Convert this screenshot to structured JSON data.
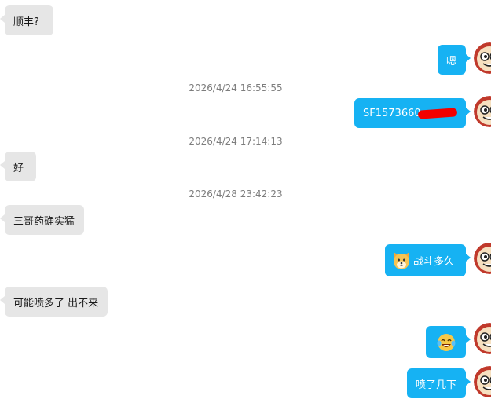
{
  "messages": [
    {
      "side": "in",
      "text": "顺丰?"
    },
    {
      "side": "out",
      "text": "嗯"
    },
    {
      "timestamp": "2026/4/24 16:55:55"
    },
    {
      "side": "out",
      "text": "SF1573660"
    },
    {
      "timestamp": "2026/4/24 17:14:13"
    },
    {
      "side": "in",
      "text": "好"
    },
    {
      "timestamp": "2026/4/28 23:42:23"
    },
    {
      "side": "in",
      "text": "三哥药确实猛"
    },
    {
      "side": "out",
      "text": "战斗多久",
      "emoji": "dog-emoji"
    },
    {
      "side": "in",
      "text": "可能喷多了 出不来"
    },
    {
      "side": "out",
      "emoji": "laughing-tears-emoji"
    },
    {
      "side": "out",
      "text": "喷了几下"
    }
  ],
  "colors": {
    "incoming_bubble": "#e6e6e6",
    "outgoing_bubble": "#16b2f3",
    "timestamp": "#7d7d7d",
    "redaction": "#f20000"
  }
}
